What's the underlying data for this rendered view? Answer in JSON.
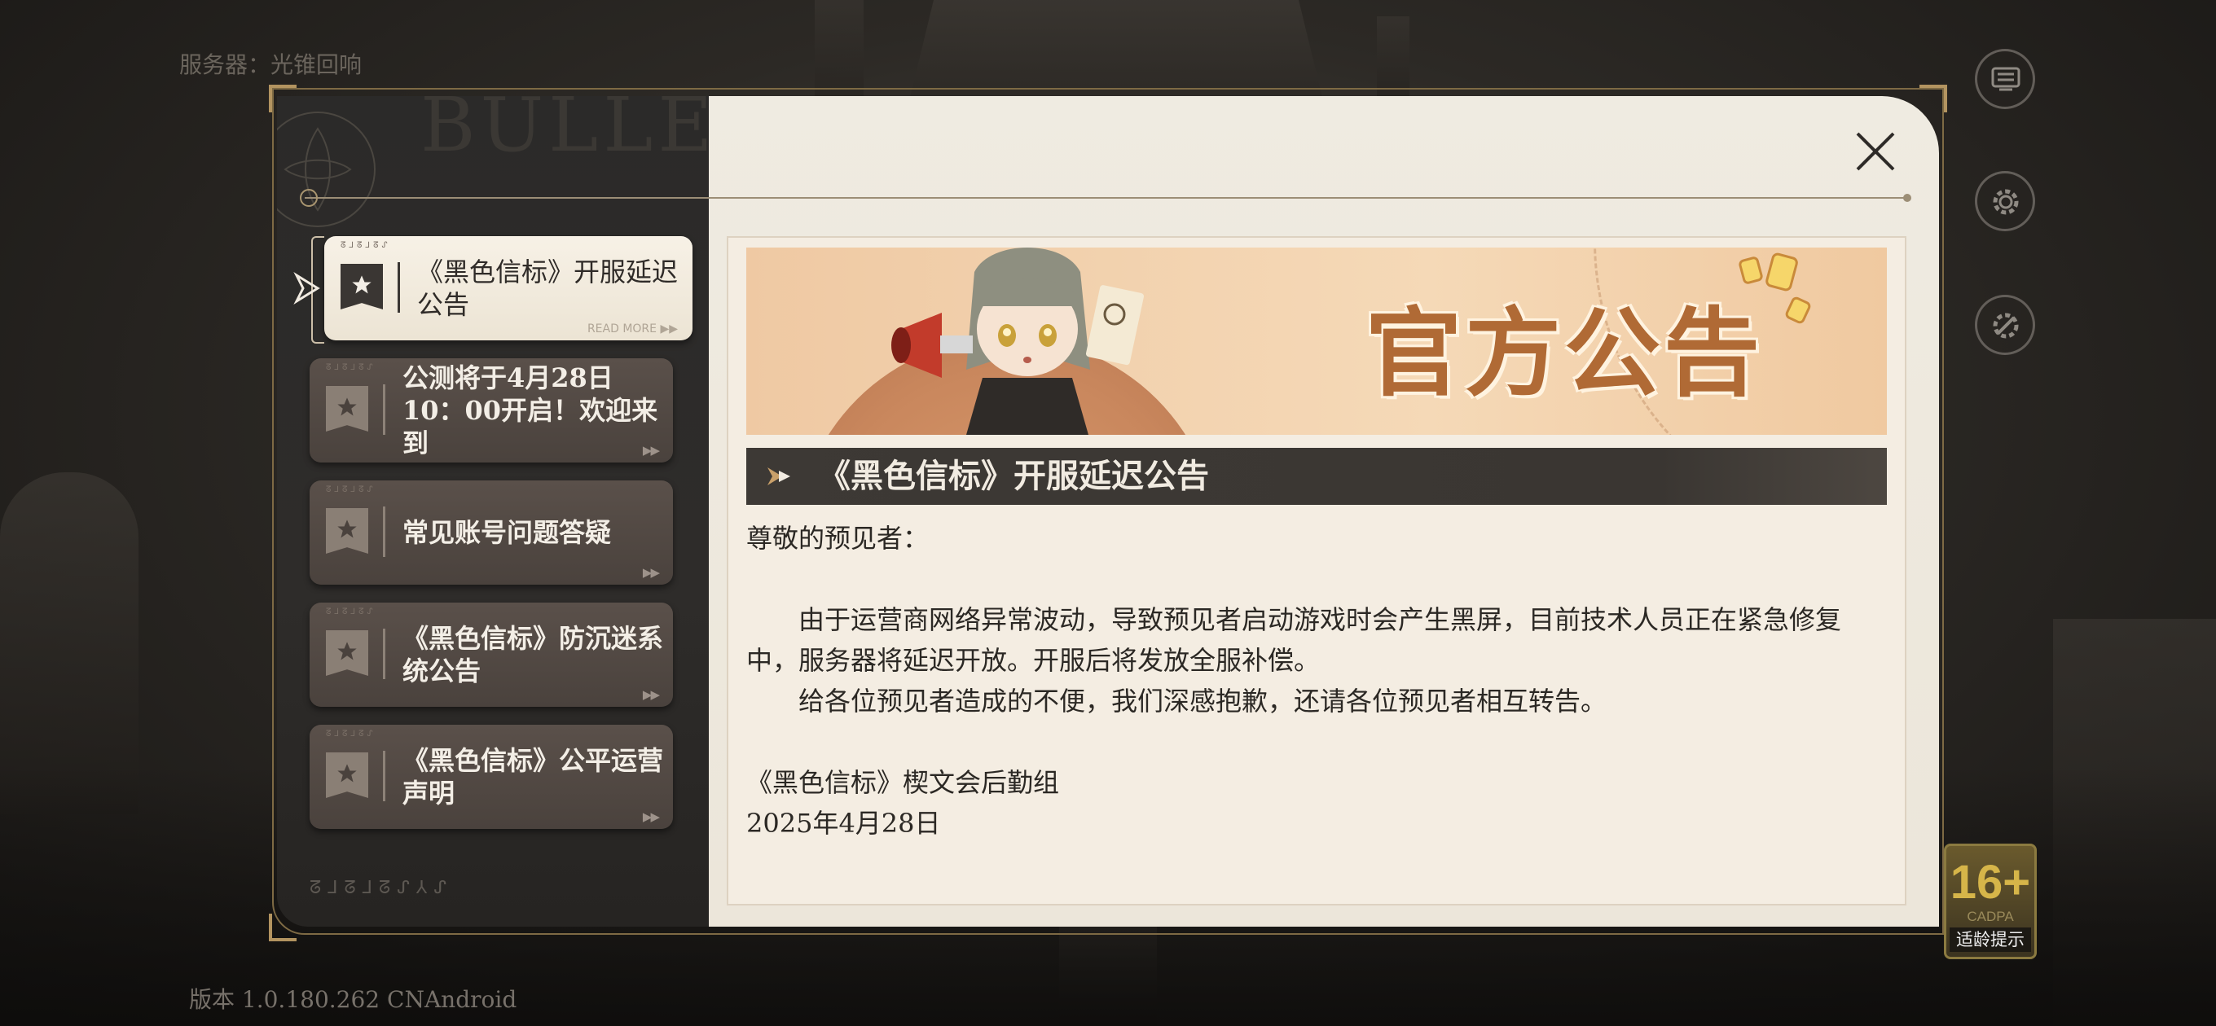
{
  "server_label": "服务器：光锥回响",
  "version_label": "版本 1.0.180.262 CNAndroid",
  "panel_heading": "BULLETIN",
  "age_rating": {
    "number": "16+",
    "org": "CADPA",
    "tip": "适龄提示"
  },
  "side_buttons": [
    "notice-board-icon",
    "gear-icon",
    "tools-gear-icon"
  ],
  "announcements": [
    {
      "title": "《黑色信标》开服延迟公告",
      "read_more": "READ MORE ▶▶",
      "active": true
    },
    {
      "title": "公测将于4月28日10：00开启！欢迎来到",
      "read_more": "▶▶",
      "active": false
    },
    {
      "title": "常见账号问题答疑",
      "read_more": "▶▶",
      "active": false
    },
    {
      "title": "《黑色信标》防沉迷系统公告",
      "read_more": "▶▶",
      "active": false
    },
    {
      "title": "《黑色信标》公平运营声明",
      "read_more": "▶▶",
      "active": false
    }
  ],
  "article": {
    "banner_title": "官方公告",
    "headline": "《黑色信标》开服延迟公告",
    "greeting": "尊敬的预见者：",
    "paragraph1": "由于运营商网络异常波动，导致预见者启动游戏时会产生黑屏，目前技术人员正在紧急修复中，服务器将延迟开放。开服后将发放全服补偿。",
    "paragraph2": "给各位预见者造成的不便，我们深感抱歉，还请各位预见者相互转告。",
    "signature": "《黑色信标》楔文会后勤组",
    "date": "2025年4月28日"
  },
  "colors": {
    "accent": "#b06a35",
    "panel_dark": "#2b2a29",
    "paper": "#efebe1",
    "frame_gold": "#7e6a44"
  }
}
